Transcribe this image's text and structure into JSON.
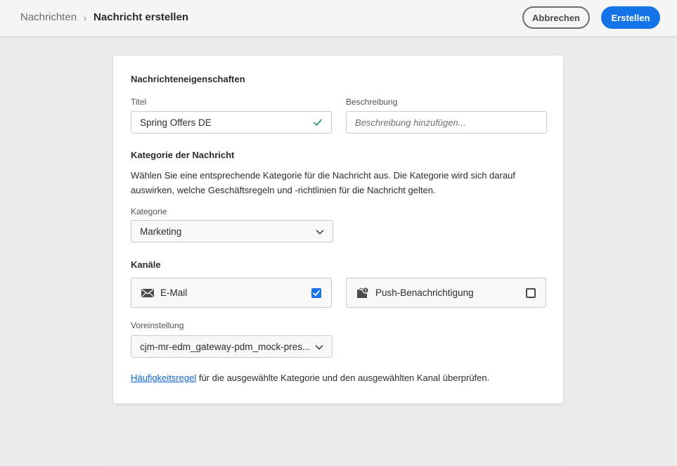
{
  "header": {
    "breadcrumb_parent": "Nachrichten",
    "breadcrumb_separator": "›",
    "breadcrumb_current": "Nachricht erstellen",
    "cancel_label": "Abbrechen",
    "create_label": "Erstellen"
  },
  "form": {
    "properties_heading": "Nachrichteneigenschaften",
    "title_label": "Titel",
    "title_value": "Spring Offers DE",
    "description_label": "Beschreibung",
    "description_placeholder": "Beschreibung hinzufügen...",
    "category_heading": "Kategorie der Nachricht",
    "category_description_line1": "Wählen Sie eine entsprechende Kategorie für die Nachricht aus. Die Kategorie wird sich darauf",
    "category_description_line2": "auswirken, welche Geschäftsregeln und -richtlinien für die Nachricht gelten.",
    "category_label": "Kategorie",
    "category_value": "Marketing",
    "channels_heading": "Kanäle",
    "channels": [
      {
        "label": "E-Mail",
        "icon": "envelope-icon",
        "checked": true
      },
      {
        "label": "Push-Benachrichtigung",
        "icon": "push-notification-icon",
        "checked": false
      }
    ],
    "preset_label": "Voreinstellung",
    "preset_value": "cjm-mr-edm_gateway-pdm_mock-pres...",
    "footer_link": "Häufigkeitsregel",
    "footer_text": " für die ausgewählte Kategorie und den ausgewählten Kanal überprüfen."
  },
  "colors": {
    "accent": "#1473e6",
    "valid": "#2d9d78",
    "link": "#0d66d0"
  }
}
